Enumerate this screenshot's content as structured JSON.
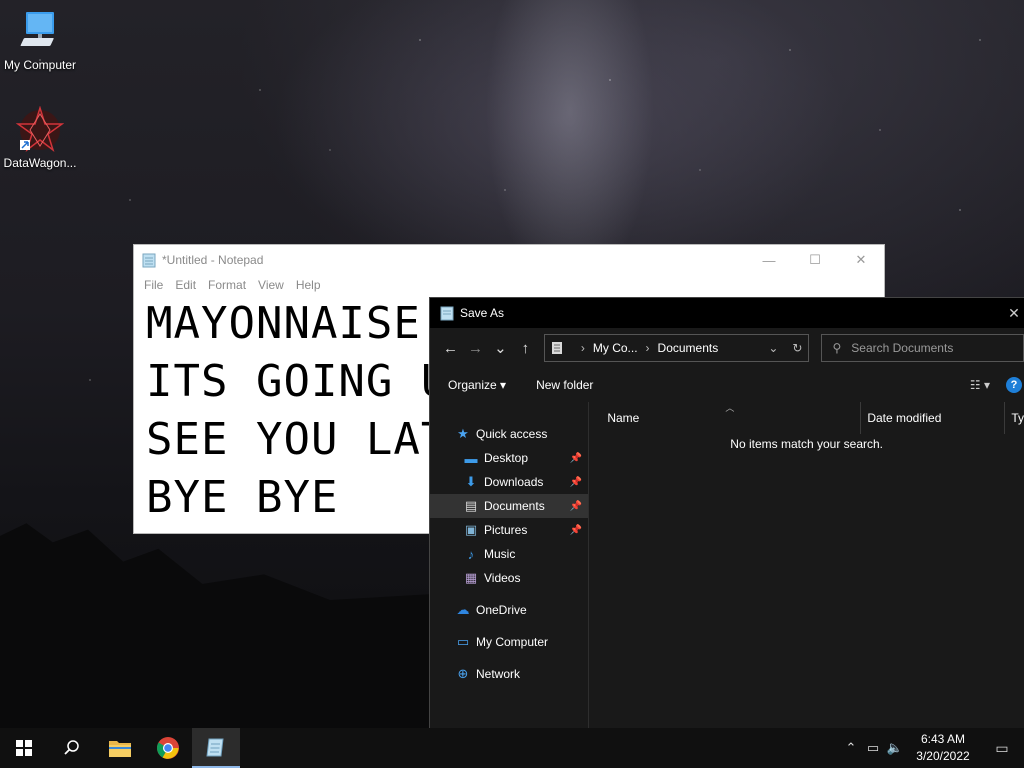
{
  "desktop": {
    "icons": [
      {
        "label": "My Computer",
        "icon": "computer-icon"
      },
      {
        "label": "DataWagon...",
        "icon": "datawagon-app-icon"
      }
    ]
  },
  "notepad": {
    "title": "*Untitled - Notepad",
    "menu": [
      "File",
      "Edit",
      "Format",
      "View",
      "Help"
    ],
    "text": "MAYONNAISE\nITS GOING U\nSEE YOU LAT\nBYE BYE",
    "controls": {
      "minimize": "—",
      "maximize": "☐",
      "close": "✕"
    }
  },
  "save_as": {
    "title": "Save As",
    "close_glyph": "✕",
    "nav": {
      "back": "←",
      "forward": "→",
      "recent": "⌄",
      "up": "↑"
    },
    "address": {
      "segments": [
        "My Co...",
        "Documents"
      ],
      "separator": "›",
      "dropdown": "⌄",
      "refresh": "↻"
    },
    "search": {
      "placeholder": "Search Documents",
      "glyph": "⚲"
    },
    "toolbar": {
      "organize": "Organize ▾",
      "new_folder": "New folder",
      "view_glyph": "☷ ▾",
      "help": "?"
    },
    "nav_pane": [
      {
        "label": "Quick access",
        "icon": "star-icon",
        "glyph": "★",
        "level": 0,
        "pinned": false,
        "color": "#4aa3f0"
      },
      {
        "label": "Desktop",
        "icon": "desktop-folder-icon",
        "glyph": "▬",
        "level": 1,
        "pinned": true,
        "color": "#3d9be9"
      },
      {
        "label": "Downloads",
        "icon": "download-icon",
        "glyph": "⬇",
        "level": 1,
        "pinned": true,
        "color": "#3d9be9"
      },
      {
        "label": "Documents",
        "icon": "document-icon",
        "glyph": "▤",
        "level": 1,
        "pinned": true,
        "selected": true,
        "color": "#d9d9d9"
      },
      {
        "label": "Pictures",
        "icon": "pictures-icon",
        "glyph": "▣",
        "level": 1,
        "pinned": true,
        "color": "#7fb3d5"
      },
      {
        "label": "Music",
        "icon": "music-icon",
        "glyph": "♪",
        "level": 1,
        "pinned": false,
        "color": "#3d9be9"
      },
      {
        "label": "Videos",
        "icon": "videos-icon",
        "glyph": "▦",
        "level": 1,
        "pinned": false,
        "color": "#b9a0d6"
      },
      {
        "label": "OneDrive",
        "icon": "cloud-icon",
        "glyph": "☁",
        "level": 0,
        "pinned": false,
        "color": "#2f86e0"
      },
      {
        "label": "My Computer",
        "icon": "computer-icon",
        "glyph": "▭",
        "level": 0,
        "pinned": false,
        "color": "#4aa3f0"
      },
      {
        "label": "Network",
        "icon": "network-icon",
        "glyph": "⊕",
        "level": 0,
        "pinned": false,
        "color": "#4aa3f0"
      }
    ],
    "columns": [
      "Name",
      "Date modified",
      "Ty"
    ],
    "empty_message": "No items match your search."
  },
  "taskbar": {
    "time": "6:43 AM",
    "date": "3/20/2022",
    "tray": {
      "chevron": "⌃",
      "network": "▭",
      "volume": "🔈"
    },
    "notification_glyph": "▭"
  },
  "colors": {
    "accent": "#1e7fd8",
    "dialog_bg": "#191919",
    "taskbar_bg": "#101010"
  }
}
